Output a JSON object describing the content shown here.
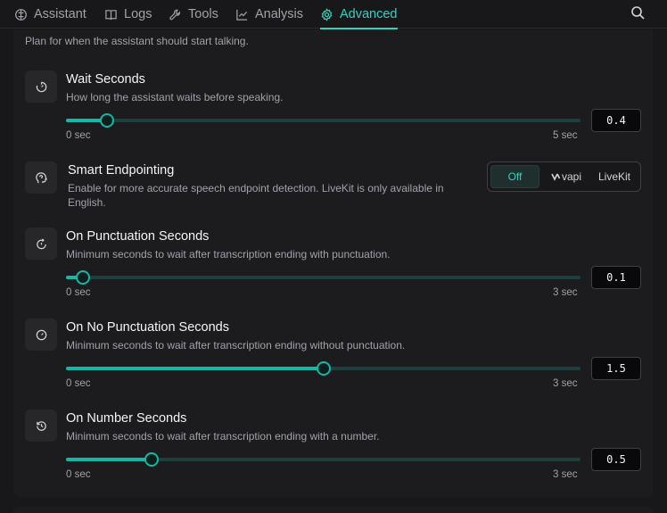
{
  "nav": {
    "tabs": [
      {
        "label": "Assistant",
        "icon": "brain-icon"
      },
      {
        "label": "Logs",
        "icon": "book-icon"
      },
      {
        "label": "Tools",
        "icon": "wrench-icon"
      },
      {
        "label": "Analysis",
        "icon": "chart-icon"
      },
      {
        "label": "Advanced",
        "icon": "gear-icon",
        "active": true
      }
    ],
    "search_icon": "search-icon"
  },
  "section": {
    "description": "Plan for when the assistant should start talking."
  },
  "wait_seconds": {
    "title": "Wait Seconds",
    "description": "How long the assistant waits before speaking.",
    "min_label": "0 sec",
    "max_label": "5 sec",
    "min": 0,
    "max": 5,
    "value": 0.4,
    "value_text": "0.4",
    "icon": "timer-icon"
  },
  "smart_endpointing": {
    "title": "Smart Endpointing",
    "description": "Enable for more accurate speech endpoint detection. LiveKit is only available in English.",
    "options": [
      "Off",
      "vapi",
      "LiveKit"
    ],
    "selected": "Off",
    "icon": "head-brain-icon"
  },
  "on_punctuation": {
    "title": "On Punctuation Seconds",
    "description": "Minimum seconds to wait after transcription ending with punctuation.",
    "min_label": "0 sec",
    "max_label": "3 sec",
    "min": 0,
    "max": 3,
    "value": 0.1,
    "value_text": "0.1",
    "icon": "timer-reset-icon"
  },
  "on_no_punctuation": {
    "title": "On No Punctuation Seconds",
    "description": "Minimum seconds to wait after transcription ending without punctuation.",
    "min_label": "0 sec",
    "max_label": "3 sec",
    "min": 0,
    "max": 3,
    "value": 1.5,
    "value_text": "1.5",
    "icon": "clock-icon"
  },
  "on_number": {
    "title": "On Number Seconds",
    "description": "Minimum seconds to wait after transcription ending with a number.",
    "min_label": "0 sec",
    "max_label": "3 sec",
    "min": 0,
    "max": 3,
    "value": 0.5,
    "value_text": "0.5",
    "icon": "history-icon"
  },
  "colors": {
    "accent": "#2dd4bf",
    "background": "#18181b",
    "panel": "#1c1c1f"
  }
}
